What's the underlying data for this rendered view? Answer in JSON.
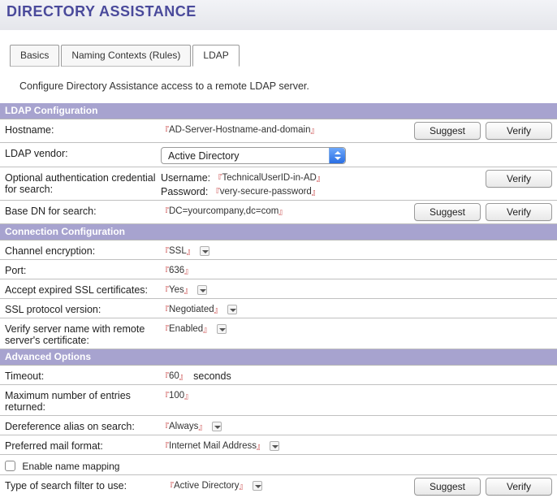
{
  "header": {
    "title": "DIRECTORY ASSISTANCE"
  },
  "tabs": {
    "basics": "Basics",
    "naming": "Naming Contexts (Rules)",
    "ldap": "LDAP"
  },
  "description": "Configure Directory Assistance access to a remote LDAP server.",
  "sections": {
    "ldapConfig": "LDAP Configuration",
    "connConfig": "Connection Configuration",
    "advOptions": "Advanced Options"
  },
  "labels": {
    "hostname": "Hostname:",
    "vendor": "LDAP vendor:",
    "optAuth": "Optional authentication credential for search:",
    "baseDn": "Base DN for search:",
    "channelEnc": "Channel encryption:",
    "port": "Port:",
    "acceptExpired": "Accept expired SSL certificates:",
    "sslProto": "SSL protocol version:",
    "verifyServer": "Verify server name with remote server's certificate:",
    "timeout": "Timeout:",
    "maxEntries": "Maximum number of entries returned:",
    "deref": "Dereference alias on search:",
    "mailFormat": "Preferred mail format:",
    "enableMapping": "Enable name mapping",
    "searchFilter": "Type of search filter to use:",
    "username": "Username:",
    "password": "Password:"
  },
  "values": {
    "hostname": "AD-Server-Hostname-and-domain",
    "vendor": "Active Directory",
    "username": "TechnicalUserID-in-AD",
    "password": "very-secure-password",
    "baseDn": "DC=yourcompany,dc=com",
    "channelEnc": "SSL",
    "port": "636",
    "acceptExpired": "Yes",
    "sslProto": "Negotiated",
    "verifyServer": "Enabled",
    "timeout": "60",
    "timeoutSuffix": "seconds",
    "maxEntries": "100",
    "deref": "Always",
    "mailFormat": "Internet Mail Address",
    "searchFilter": "Active Directory"
  },
  "buttons": {
    "suggest": "Suggest",
    "verify": "Verify"
  }
}
